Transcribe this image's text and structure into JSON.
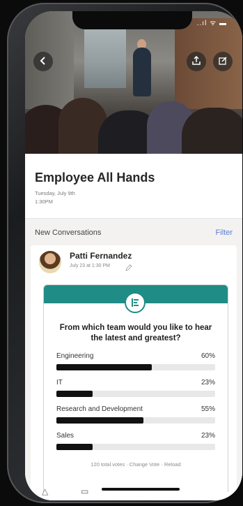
{
  "status_bar": {
    "icons": "..ıl ᯤ ▬"
  },
  "hero": {
    "back_icon": "chevron-left-icon",
    "share_icon": "share-icon",
    "edit_icon": "edit-icon"
  },
  "event": {
    "title": "Employee All Hands",
    "date": "Tuesday, July 9th",
    "time": "1:30PM"
  },
  "conversations": {
    "heading": "New Conversations",
    "filter_label": "Filter"
  },
  "post": {
    "author": "Patti Fernandez",
    "timestamp": "July 23 at 1:30 PM"
  },
  "poll": {
    "question": "From which team would you like to hear the latest and greatest?",
    "options": [
      {
        "label": "Engineering",
        "percent_text": "60%",
        "value": 0.6
      },
      {
        "label": "IT",
        "percent_text": "23%",
        "value": 0.23
      },
      {
        "label": "Research and Development",
        "percent_text": "55%",
        "value": 0.55
      },
      {
        "label": "Sales",
        "percent_text": "23%",
        "value": 0.23
      }
    ],
    "footer": "120 total votes · Change Vote · Reload"
  },
  "colors": {
    "accent_teal": "#1f8c86",
    "link_blue": "#5c7bd6",
    "bar_fill": "#111111"
  }
}
